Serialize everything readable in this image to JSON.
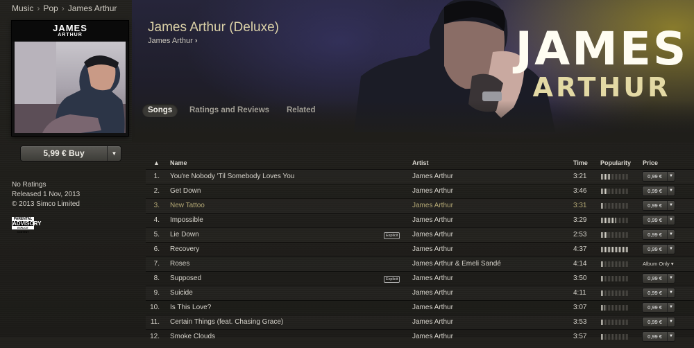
{
  "breadcrumb": [
    "Music",
    "Pop",
    "James Arthur"
  ],
  "album": {
    "title": "James Arthur (Deluxe)",
    "artist": "James Arthur",
    "cover_line1": "JAMES",
    "cover_line2": "ARTHUR",
    "hero_line1": "JAMES",
    "hero_line2": "ARTHUR"
  },
  "buy": {
    "label": "5,99 € Buy"
  },
  "meta": {
    "ratings": "No Ratings",
    "released": "Released 1 Nov, 2013",
    "copyright": "© 2013 Simco Limited",
    "parental_top": "PARENTAL",
    "parental_mid": "ADVISORY",
    "parental_bot": "EXPLICIT CONTENT"
  },
  "tabs": [
    "Songs",
    "Ratings and Reviews",
    "Related"
  ],
  "columns": {
    "sort": "▲",
    "name": "Name",
    "artist": "Artist",
    "time": "Time",
    "popularity": "Popularity",
    "price": "Price"
  },
  "explicit_label": "Explicit",
  "tracks": [
    {
      "num": "1.",
      "name": "You're Nobody 'Til Somebody Loves You",
      "artist": "James Arthur",
      "time": "3:21",
      "popularity": 0.35,
      "price": "0,99 €",
      "explicit": false
    },
    {
      "num": "2.",
      "name": "Get Down",
      "artist": "James Arthur",
      "time": "3:46",
      "popularity": 0.25,
      "price": "0,99 €",
      "explicit": false
    },
    {
      "num": "3.",
      "name": "New Tattoo",
      "artist": "James Arthur",
      "time": "3:31",
      "popularity": 0.1,
      "price": "0,99 €",
      "explicit": false
    },
    {
      "num": "4.",
      "name": "Impossible",
      "artist": "James Arthur",
      "time": "3:29",
      "popularity": 0.55,
      "price": "0,99 €",
      "explicit": false
    },
    {
      "num": "5.",
      "name": "Lie Down",
      "artist": "James Arthur",
      "time": "2:53",
      "popularity": 0.25,
      "price": "0,99 €",
      "explicit": true
    },
    {
      "num": "6.",
      "name": "Recovery",
      "artist": "James Arthur",
      "time": "4:37",
      "popularity": 1.0,
      "price": "0,99 €",
      "explicit": false
    },
    {
      "num": "7.",
      "name": "Roses",
      "artist": "James Arthur & Emeli Sandé",
      "time": "4:14",
      "popularity": 0.1,
      "price": "Album Only ▾",
      "explicit": false,
      "album_only": true
    },
    {
      "num": "8.",
      "name": "Supposed",
      "artist": "James Arthur",
      "time": "3:50",
      "popularity": 0.1,
      "price": "0,99 €",
      "explicit": true
    },
    {
      "num": "9.",
      "name": "Suicide",
      "artist": "James Arthur",
      "time": "4:11",
      "popularity": 0.1,
      "price": "0,99 €",
      "explicit": false
    },
    {
      "num": "10.",
      "name": "Is This Love?",
      "artist": "James Arthur",
      "time": "3:07",
      "popularity": 0.15,
      "price": "0,99 €",
      "explicit": false
    },
    {
      "num": "11.",
      "name": "Certain Things (feat. Chasing Grace)",
      "artist": "James Arthur",
      "time": "3:53",
      "popularity": 0.1,
      "price": "0,99 €",
      "explicit": false
    },
    {
      "num": "12.",
      "name": "Smoke Clouds",
      "artist": "James Arthur",
      "time": "3:57",
      "popularity": 0.1,
      "price": "0,99 €",
      "explicit": false
    }
  ]
}
